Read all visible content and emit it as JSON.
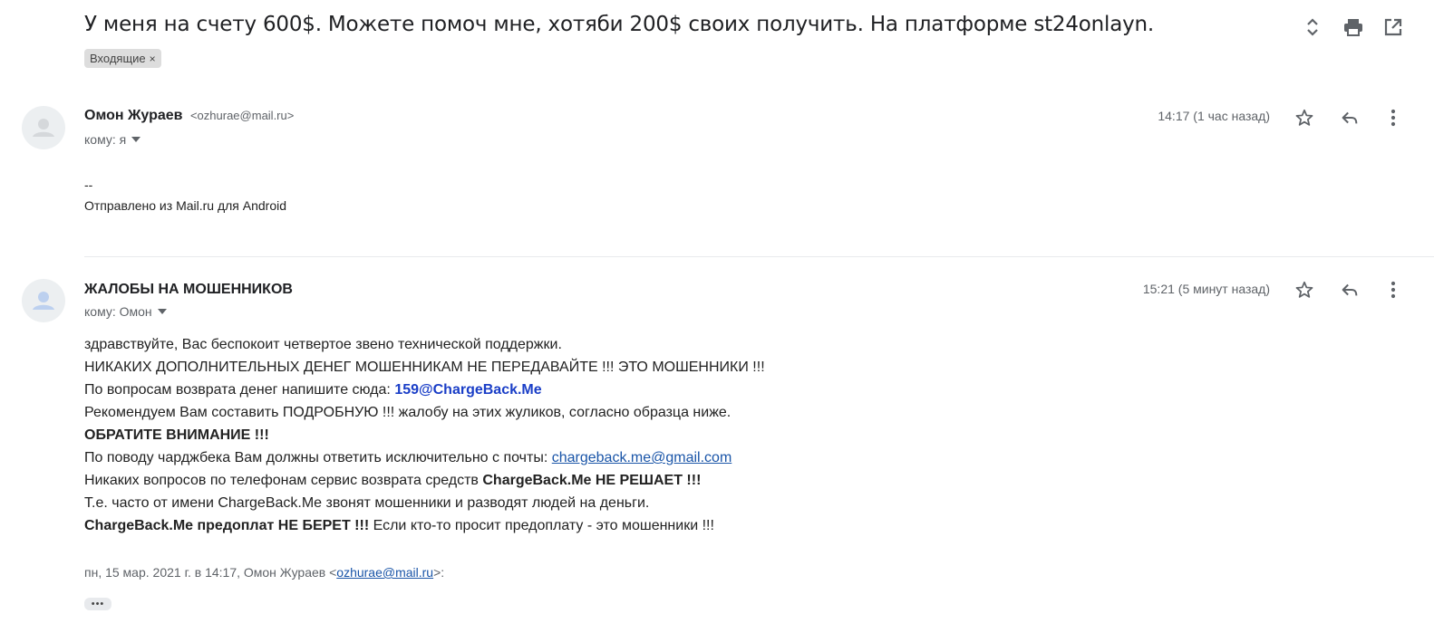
{
  "subject": "У меня на счету 600$. Можете помоч мне, хотяби 200$ своих получить. На платформе st24onlayn.",
  "label": {
    "name": "Входящие",
    "remove": "×"
  },
  "messages": [
    {
      "sender": "Омон Жураев",
      "email": "<ozhurae@mail.ru>",
      "to": "кому: я",
      "time": "14:17 (1 час назад)",
      "body": [
        "--",
        "Отправлено из Mail.ru для Android"
      ]
    },
    {
      "sender": "ЖАЛОБЫ НА МОШЕННИКОВ",
      "to": "кому: Омон",
      "time": "15:21 (5 минут назад)",
      "body": {
        "line1": "здравствуйте, Вас беспокоит четвертое звено технической поддержки.",
        "line2": "НИКАКИХ ДОПОЛНИТЕЛЬНЫХ ДЕНЕГ МОШЕННИКАМ НЕ ПЕРЕДАВАЙТЕ !!! ЭТО МОШЕННИКИ !!!",
        "line3_prefix": "По вопросам возврата денег напишите сюда: ",
        "line3_email": "159@ChargeBack.Me",
        "line4": "Рекомендуем Вам составить ПОДРОБНУЮ !!! жалобу на этих жуликов, согласно образца ниже.",
        "line5": "ОБРАТИТЕ ВНИМАНИЕ !!!",
        "line6_prefix": "По поводу чарджбека Вам должны ответить исключительно с почты: ",
        "line6_link": "chargeback.me@gmail.com",
        "line7_prefix": "Никаких вопросов по телефонам сервис возврата средств ",
        "line7_bold": "ChargeBack.Me НЕ РЕШАЕТ !!!",
        "line8": "Т.е. часто от имени ChargeBack.Me звонят мошенники и разводят людей на деньги.",
        "line9_bold": "ChargeBack.Me предоплат НЕ БЕРЕТ !!!",
        "line9_suffix": " Если кто-то просит предоплату - это мошенники !!!"
      },
      "quote": {
        "prefix": "пн, 15 мар. 2021 г. в 14:17, Омон Жураев <",
        "link": "ozhurae@mail.ru",
        "suffix": ">:"
      },
      "trimmed": "•••"
    }
  ],
  "icons": {
    "expand": "unfold-icon",
    "print": "print-icon",
    "new_window": "open-in-new-icon",
    "star": "star-icon",
    "reply": "reply-icon",
    "more": "more-vert-icon",
    "avatar": "person-icon",
    "dropdown": "caret-down-icon"
  },
  "colors": {
    "link": "#1a55a8",
    "email_bold": "#1a3ec7",
    "chip_bg": "#dddddd",
    "muted": "#5f6368"
  }
}
